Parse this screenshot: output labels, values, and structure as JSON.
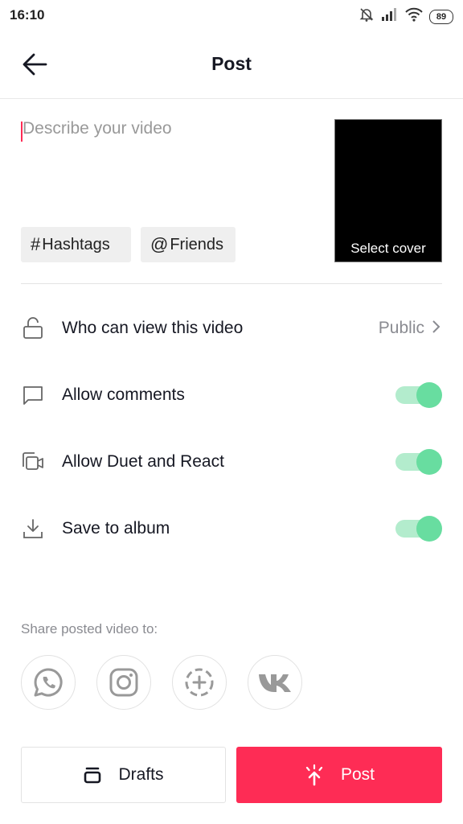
{
  "status_bar": {
    "time": "16:10",
    "icons": [
      "muted-bell-icon",
      "signal-icon",
      "wifi-icon"
    ],
    "battery": "89"
  },
  "header": {
    "back_icon": "arrow-left-icon",
    "title": "Post"
  },
  "description": {
    "value": "",
    "placeholder": "Describe your video"
  },
  "chips": {
    "hashtags": {
      "symbol": "#",
      "label": "Hashtags"
    },
    "friends": {
      "symbol": "@",
      "label": "Friends"
    }
  },
  "cover": {
    "label": "Select cover"
  },
  "settings": [
    {
      "icon": "lock-open-icon",
      "label": "Who can view this video",
      "value": "Public"
    },
    {
      "icon": "comment-icon",
      "label": "Allow comments",
      "enabled": true
    },
    {
      "icon": "duet-icon",
      "label": "Allow Duet and React",
      "enabled": true
    },
    {
      "icon": "download-icon",
      "label": "Save to album",
      "enabled": true
    }
  ],
  "share": {
    "label": "Share posted video to:",
    "targets": [
      "whatsapp-icon",
      "instagram-icon",
      "add-story-icon",
      "vk-icon"
    ]
  },
  "actions": {
    "drafts_label": "Drafts",
    "post_label": "Post"
  },
  "colors": {
    "accent": "#fe2c55",
    "toggle_on": "#68dda0",
    "toggle_track": "#b3eccd"
  }
}
